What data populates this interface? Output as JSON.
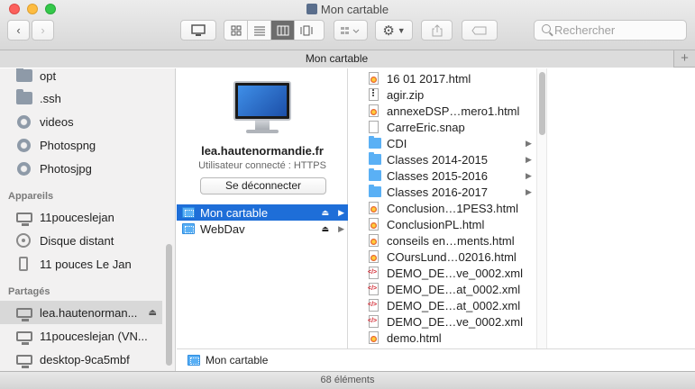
{
  "window": {
    "title": "Mon cartable"
  },
  "search": {
    "placeholder": "Rechercher"
  },
  "tab": {
    "label": "Mon cartable",
    "add_label": "+"
  },
  "sidebar": {
    "favorites": [
      {
        "label": "opt",
        "icon": "folder-icon"
      },
      {
        "label": ".ssh",
        "icon": "folder-icon"
      },
      {
        "label": "videos",
        "icon": "gear-folder-icon"
      },
      {
        "label": "Photospng",
        "icon": "gear-folder-icon"
      },
      {
        "label": "Photosjpg",
        "icon": "gear-folder-icon"
      }
    ],
    "devices_heading": "Appareils",
    "devices": [
      {
        "label": "11pouceslejan",
        "icon": "display-icon"
      },
      {
        "label": "Disque distant",
        "icon": "disk-icon"
      },
      {
        "label": "11 pouces Le Jan",
        "icon": "phone-icon"
      }
    ],
    "shared_heading": "Partagés",
    "shared": [
      {
        "label": "lea.hautenorman...",
        "icon": "display-icon",
        "eject": "⏏"
      },
      {
        "label": "11pouceslejan (VN...",
        "icon": "display-icon"
      },
      {
        "label": "desktop-9ca5mbf",
        "icon": "display-icon"
      }
    ]
  },
  "server": {
    "name": "lea.hautenormandie.fr",
    "status": "Utilisateur connecté : HTTPS",
    "disconnect_label": "Se déconnecter",
    "shares": [
      {
        "label": "Mon cartable",
        "selected": true
      },
      {
        "label": "WebDav",
        "selected": false
      }
    ]
  },
  "files": [
    {
      "name": "16 01 2017.html",
      "type": "html"
    },
    {
      "name": "agir.zip",
      "type": "zip"
    },
    {
      "name": "annexeDSP…mero1.html",
      "type": "html"
    },
    {
      "name": "CarreEric.snap",
      "type": "doc"
    },
    {
      "name": "CDI",
      "type": "folder"
    },
    {
      "name": "Classes 2014-2015",
      "type": "folder"
    },
    {
      "name": "Classes 2015-2016",
      "type": "folder"
    },
    {
      "name": "Classes 2016-2017",
      "type": "folder"
    },
    {
      "name": "Conclusion…1PES3.html",
      "type": "html"
    },
    {
      "name": "ConclusionPL.html",
      "type": "html"
    },
    {
      "name": "conseils en…ments.html",
      "type": "html"
    },
    {
      "name": "COursLund…02016.html",
      "type": "html"
    },
    {
      "name": "DEMO_DE…ve_0002.xml",
      "type": "xml"
    },
    {
      "name": "DEMO_DE…at_0002.xml",
      "type": "xml"
    },
    {
      "name": "DEMO_DE…at_0002.xml",
      "type": "xml"
    },
    {
      "name": "DEMO_DE…ve_0002.xml",
      "type": "xml"
    },
    {
      "name": "demo.html",
      "type": "html"
    }
  ],
  "pathbar": {
    "label": "Mon cartable"
  },
  "status": {
    "count": "68 éléments"
  }
}
